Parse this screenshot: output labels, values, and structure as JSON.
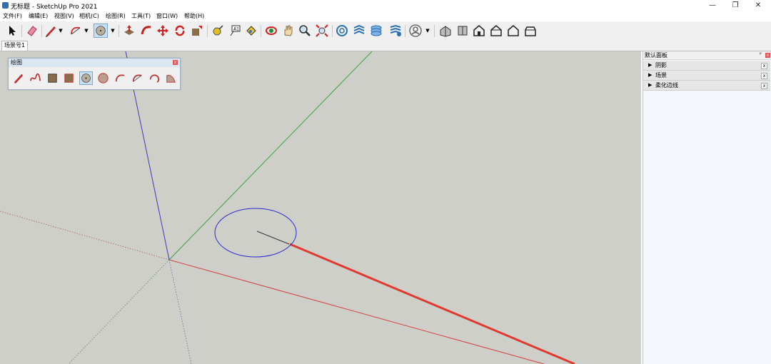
{
  "window": {
    "title": "无标题 - SketchUp Pro 2021",
    "minimize": "—",
    "restore": "❐",
    "close": "✕"
  },
  "menu": [
    "文件(F)",
    "编辑(E)",
    "视图(V)",
    "相机(C)",
    "绘图(R)",
    "工具(T)",
    "窗口(W)",
    "帮助(H)"
  ],
  "toolbar": {
    "icons": [
      "select-icon",
      "eraser-icon",
      "pencil-icon",
      "arc-icon",
      "circle-icon",
      "push-pull-icon",
      "follow-me-icon",
      "move-icon",
      "rotate-icon",
      "scale-icon",
      "tape-measure-icon",
      "text-icon",
      "paint-bucket-icon",
      "orbit-icon",
      "pan-icon",
      "zoom-icon",
      "zoom-extents-icon",
      "warehouse-icon",
      "extension-icon",
      "layers-icon",
      "sandbox-icon",
      "account-icon",
      "iso-view-icon",
      "top-view-icon",
      "front-view-icon",
      "right-view-icon",
      "back-view-icon",
      "left-view-icon"
    ]
  },
  "scene_tab": "场景号1",
  "drawing_palette": {
    "title": "绘图",
    "close": "x",
    "tools": [
      "pencil-icon",
      "freehand-icon",
      "rectangle-icon",
      "rotated-rectangle-icon",
      "circle-icon",
      "polygon-icon",
      "arc-icon",
      "2point-arc-icon",
      "3point-arc-icon",
      "pie-icon"
    ]
  },
  "tray": {
    "title": "默认面板",
    "pin": "ᵖ",
    "close": "x",
    "panels": [
      {
        "label": "阴影",
        "arrow": "▶",
        "close": "x"
      },
      {
        "label": "场景",
        "arrow": "▶",
        "close": "x"
      },
      {
        "label": "柔化边线",
        "arrow": "▶",
        "close": "x"
      }
    ]
  },
  "colors": {
    "red_axis": "#e03a30",
    "green_axis": "#3aa33a",
    "blue_axis": "#3a3ab8",
    "circle": "#2a2ad0",
    "viewport_bg": "#cfcfca"
  }
}
